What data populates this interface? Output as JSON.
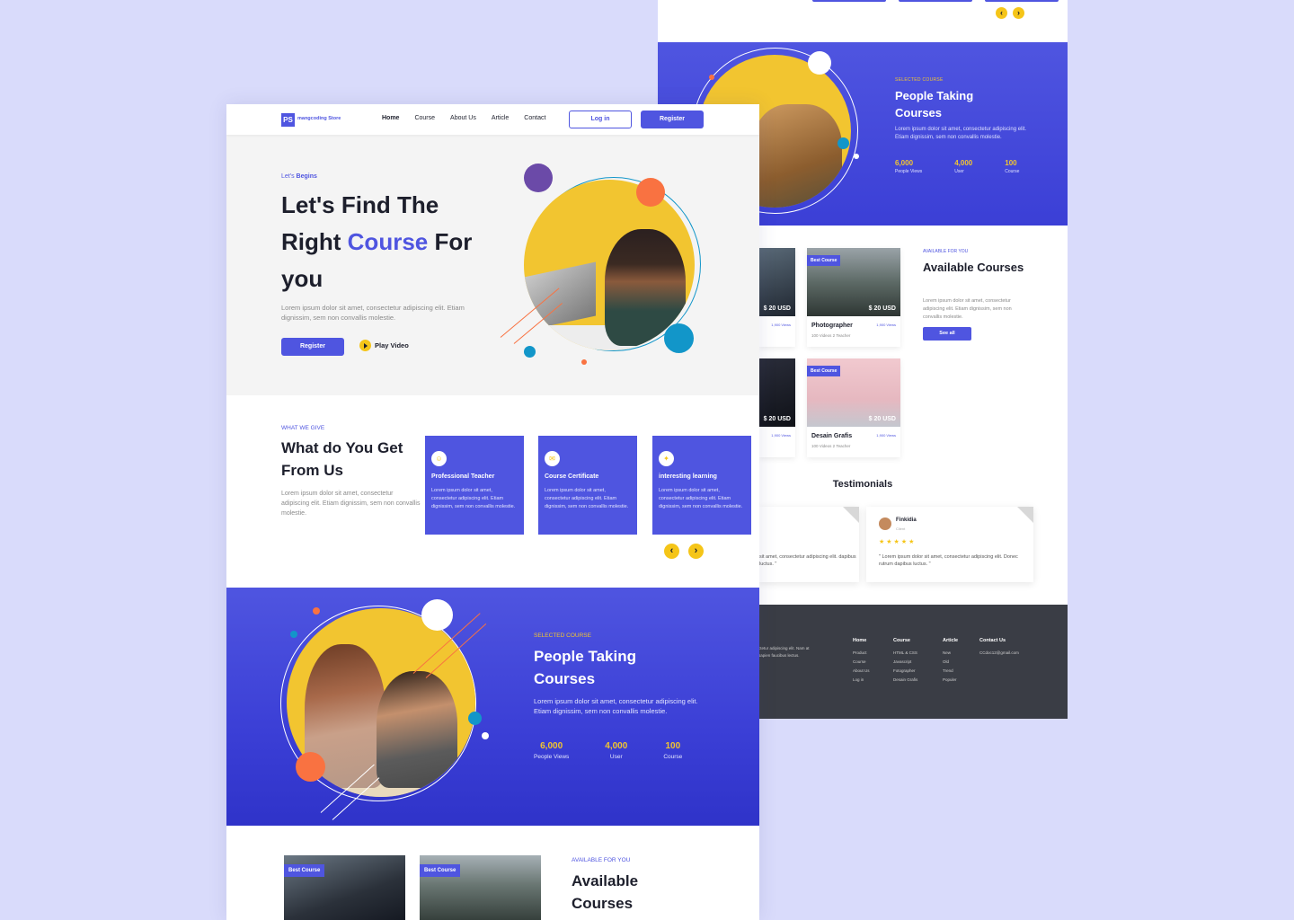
{
  "brand": {
    "name": "mangcoding Store",
    "logo_letters": "PS",
    "accent": "#4f55e0",
    "yellow": "#f2c530",
    "orange": "#f97241",
    "teal": "#1296c9"
  },
  "nav": {
    "links": [
      "Home",
      "Course",
      "About Us",
      "Article",
      "Contact"
    ],
    "active": "Home",
    "login_label": "Log in",
    "register_label": "Register"
  },
  "hero": {
    "tag_prefix": "Let's",
    "tag_bold": "Begins",
    "title_line1": "Let's Find The",
    "title_line2_a": "Right ",
    "title_line2_accent": "Course",
    "title_line2_b": " For",
    "title_line3": "you",
    "description": "Lorem ipsum dolor sit amet, consectetur adipiscing elit. Etiam dignissim, sem non convallis molestie.",
    "register_label": "Register",
    "play_label": "Play Video"
  },
  "give": {
    "tag": "WHAT WE GIVE",
    "title": "What do You Get From Us",
    "description": "Lorem ipsum dolor sit amet, consectetur adipiscing elit. Etiam dignissim, sem non convallis molestie.",
    "features": [
      {
        "icon": "teacher-icon",
        "title": "Professional Teacher",
        "desc": "Lorem ipsum dolor sit amet, consectetur adipiscing elit. Etiam dignissim, sem non convallis molestie."
      },
      {
        "icon": "certificate-icon",
        "title": "Course Certificate",
        "desc": "Lorem ipsum dolor sit amet, consectetur adipiscing elit. Etiam dignissim, sem non convallis molestie."
      },
      {
        "icon": "bulb-icon",
        "title": "interesting learning",
        "desc": "Lorem ipsum dolor sit amet, consectetur adipiscing elit. Etiam dignissim, sem non convallis molestie."
      }
    ],
    "prev": "‹",
    "next": "›"
  },
  "selected": {
    "tag": "SELECTED COURSE",
    "title": "People Taking Courses",
    "description": "Lorem ipsum dolor sit amet, consectetur adipiscing elit. Etiam dignissim, sem non convallis molestie.",
    "stats": [
      {
        "value": "6,000",
        "label": "People Views"
      },
      {
        "value": "4,000",
        "label": "User"
      },
      {
        "value": "100",
        "label": "Course"
      }
    ]
  },
  "available": {
    "tag": "AVAILABLE FOR YOU",
    "title": "Available Courses",
    "description": "Lorem ipsum dolor sit amet, consectetur adipiscing elit. Etiam dignissim, sem non convallis molestie.",
    "see_all": "See all",
    "badge": "Best Course",
    "cards": [
      {
        "name": "",
        "price": "$ 20 USD",
        "views": "1,900 Views",
        "meta": ""
      },
      {
        "name": "Photographer",
        "price": "$ 20 USD",
        "views": "1,900 Views",
        "meta": "100 Videos   2 Teacher"
      },
      {
        "name": "",
        "price": "$ 20 USD",
        "views": "1,900 Views",
        "meta": ""
      },
      {
        "name": "Desain Grafis",
        "price": "$ 20 USD",
        "views": "1,900 Views",
        "meta": "100 Videos   2 Teacher"
      }
    ]
  },
  "testimonials": {
    "title": "Testimonials",
    "left_quote": "sit amet, consectetur adipiscing elit. dapibus luctus. \"",
    "right": {
      "name": "Finkidia",
      "role": "Client",
      "stars": "★★★★★",
      "quote": "\" Lorem ipsum dolor sit amet, consectetur adipiscing elit. Donec rutrum dapibus luctus. \""
    }
  },
  "footer": {
    "text": "ctetur adipiscing elit. Nam at sapien faucibus lectus.",
    "columns": [
      {
        "heading": "Home",
        "items": [
          "Product",
          "Course",
          "About Us",
          "Log in"
        ]
      },
      {
        "heading": "Course",
        "items": [
          "HTML & CSS",
          "Javascript",
          "Fotographer",
          "Desain Grafis"
        ]
      },
      {
        "heading": "Article",
        "items": [
          "New",
          "Old",
          "Trend",
          "Populer"
        ]
      },
      {
        "heading": "Contact Us",
        "items": [
          "CCdoc12@gmail.com"
        ]
      }
    ]
  }
}
